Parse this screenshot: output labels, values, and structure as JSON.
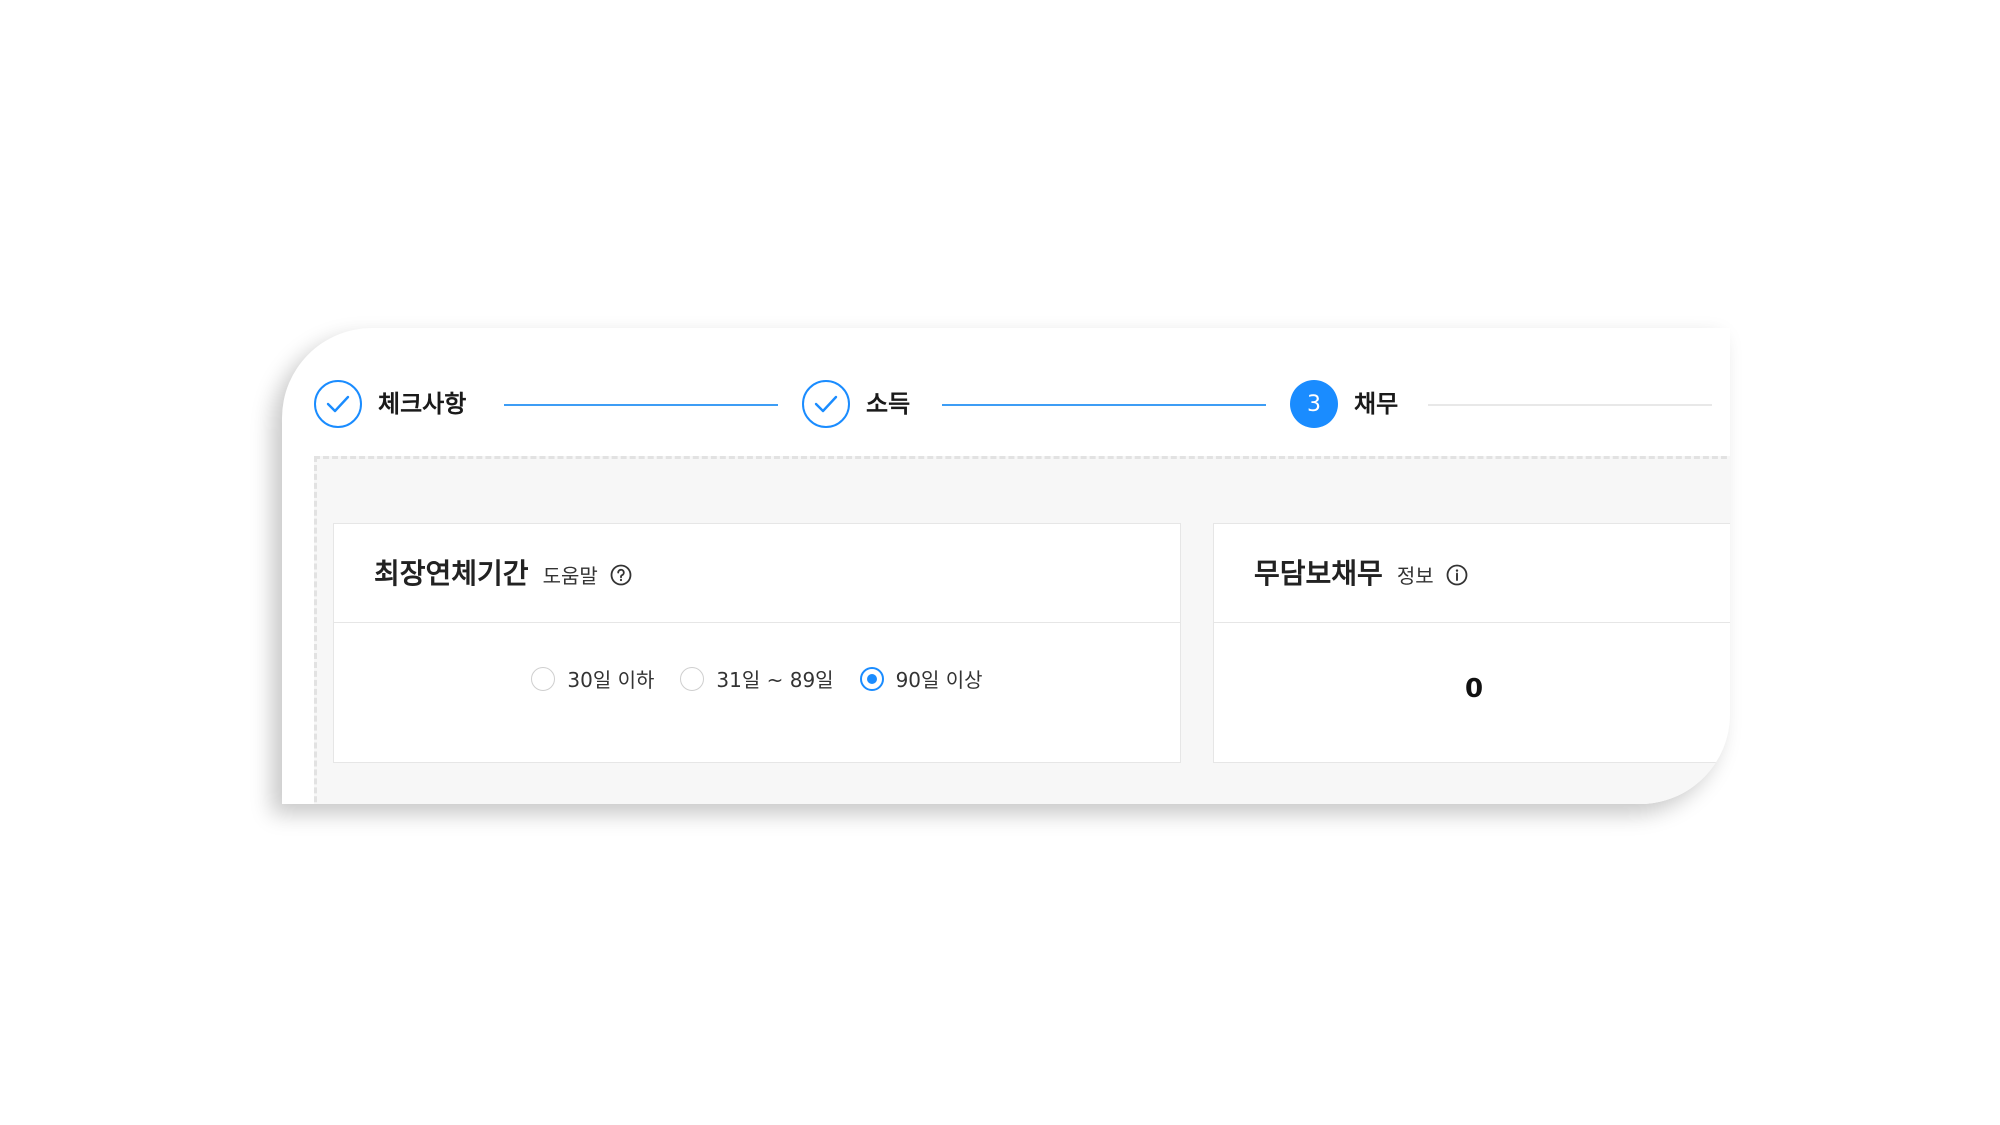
{
  "stepper": {
    "steps": [
      {
        "label": "체크사항",
        "state": "done",
        "icon": "check-icon"
      },
      {
        "label": "소득",
        "state": "done",
        "icon": "check-icon"
      },
      {
        "label": "채무",
        "state": "active",
        "number": "3"
      }
    ]
  },
  "overdue_card": {
    "title": "최장연체기간",
    "sub_label": "도움말",
    "icon": "question-circle-icon",
    "options": [
      {
        "label": "30일 이하",
        "checked": false
      },
      {
        "label": "31일 ~ 89일",
        "checked": false
      },
      {
        "label": "90일 이상",
        "checked": true
      }
    ]
  },
  "unsecured_card": {
    "title": "무담보채무",
    "sub_label": "정보",
    "icon": "info-circle-icon",
    "value": "0"
  },
  "colors": {
    "accent": "#1a8cff",
    "line": "#3d9df5",
    "border": "#e6e6e6",
    "area_bg": "#f7f7f7"
  }
}
